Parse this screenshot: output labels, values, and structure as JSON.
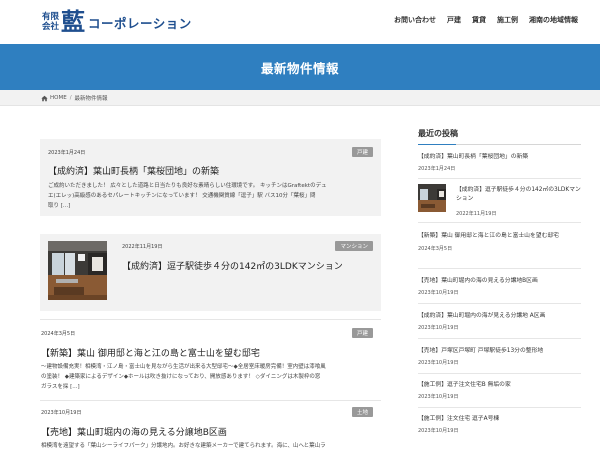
{
  "header": {
    "logo_line1": "有限",
    "logo_line2": "会社",
    "logo_kanji": "藍",
    "logo_katakana": "コーポレーション",
    "nav": [
      "お問い合わせ",
      "戸建",
      "賃貸",
      "施工例",
      "湘南の地域情報"
    ]
  },
  "hero": {
    "title": "最新物件情報"
  },
  "breadcrumb": {
    "home": "HOME",
    "separator": "/",
    "current": "最新物件情報"
  },
  "posts": [
    {
      "date": "2023年1月24日",
      "badge": "戸建",
      "title": "【成約済】葉山町長柄「葉桜団地」の新築",
      "excerpt_lines": [
        "ご成約いただきました！ 広々とした道路と日当たりも良好な素晴らしい住環境です。 キッチンはGraftektのデュ",
        "エ(エレッ)高級感のあるセパレートキッチンになっています！ 交通機関質線「逗子」駅 バス10分「葉桜」問",
        "取り [...]"
      ]
    },
    {
      "date": "2022年11月19日",
      "badge": "マンション",
      "title": "【成約済】逗子駅徒歩４分の142㎡の3LDKマンション"
    },
    {
      "date": "2024年3月5日",
      "badge": "戸建",
      "title": "【新築】葉山 御用邸と海と江の島と富士山を望む邸宅",
      "excerpt_lines": [
        "～建物設備充実！相模湾・江ノ島・富士山を見ながら生活が出来る大型邸宅～◆全居室床暖房完備！室内壁は漆喰風",
        "の塗装！ ◆建築家によるデザイン◆ホールは吹き抜けになっており、開放感あります！ ◇ダイニングは木製枠の窓",
        "ガラスを採 [...]"
      ]
    },
    {
      "date": "2023年10月19日",
      "badge": "土地",
      "title": "【売地】葉山町堀内の海の見える分譲地B区画",
      "excerpt_lines": [
        "相模湾を遠望する「葉山シーライフパーク」分譲地内。お好きな建築メーカーで建てられます。海に、山へと葉山ラ"
      ]
    }
  ],
  "sidebar": {
    "heading": "最近の投稿",
    "items": [
      {
        "title": "【成約済】葉山町長柄「葉桜団地」の新築",
        "date": "2023年1月24日"
      },
      {
        "title": "【成約済】逗子駅徒歩４分の142㎡の3LDKマンション",
        "date": "2022年11月19日"
      },
      {
        "title": "【新築】葉山 御用邸と海と江の島と富士山を望む邸宅",
        "date": "2024年3月5日"
      },
      {
        "title": "【売地】葉山町堀内の海の見える分譲地B区画",
        "date": "2023年10月19日"
      },
      {
        "title": "【成約済】葉山町堀内の海が見える分譲地 A区画",
        "date": "2023年10月19日"
      },
      {
        "title": "【売地】戸塚区戸塚町 戸塚駅徒歩13分の整形地",
        "date": "2023年10月19日"
      },
      {
        "title": "【施工例】逗子注文住宅B 無垢の家",
        "date": "2023年10月19日"
      },
      {
        "title": "【施工例】注文住宅 逗子A号棟",
        "date": "2023年10月19日"
      }
    ]
  },
  "colors": {
    "brand_blue": "#1f4f8f",
    "hero_blue": "#2f7fc0",
    "badge_gray": "#999999"
  }
}
